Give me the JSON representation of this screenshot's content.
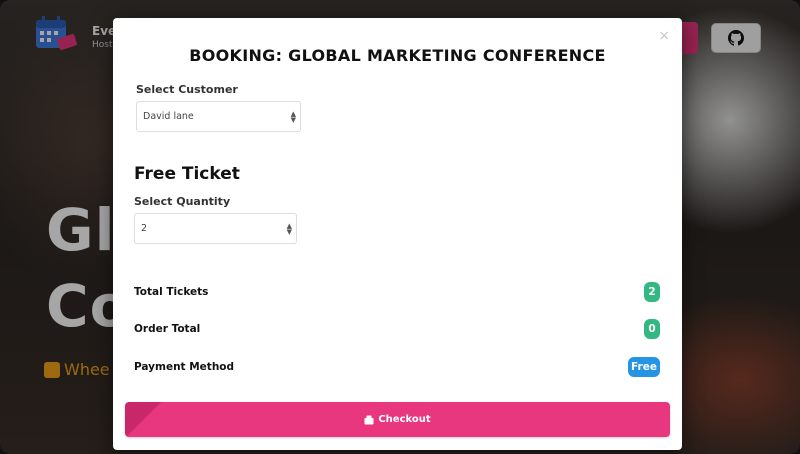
{
  "background": {
    "brand_title": "Eve",
    "brand_sub": "Host",
    "hero_line1": "Gl",
    "hero_line2": "Co",
    "venue_text": "Whee"
  },
  "modal": {
    "title": "BOOKING: GLOBAL MARKETING CONFERENCE",
    "close_symbol": "×",
    "customer": {
      "label": "Select Customer",
      "value": "David lane"
    },
    "ticket": {
      "heading": "Free Ticket",
      "quantity_label": "Select Quantity",
      "quantity_value": "2"
    },
    "summary": {
      "total_tickets_label": "Total Tickets",
      "total_tickets_value": "2",
      "order_total_label": "Order Total",
      "order_total_value": "0",
      "payment_method_label": "Payment Method",
      "payment_method_value": "Free"
    },
    "checkout_label": "Checkout"
  },
  "icons": {
    "logo": "calendar-ticket-icon",
    "github": "github-icon",
    "venue": "map-icon",
    "checkout": "ticket-icon"
  },
  "colors": {
    "accent": "#e8367f",
    "badge_green": "#33b883",
    "badge_blue": "#2594e3",
    "venue": "#f3a21b"
  }
}
